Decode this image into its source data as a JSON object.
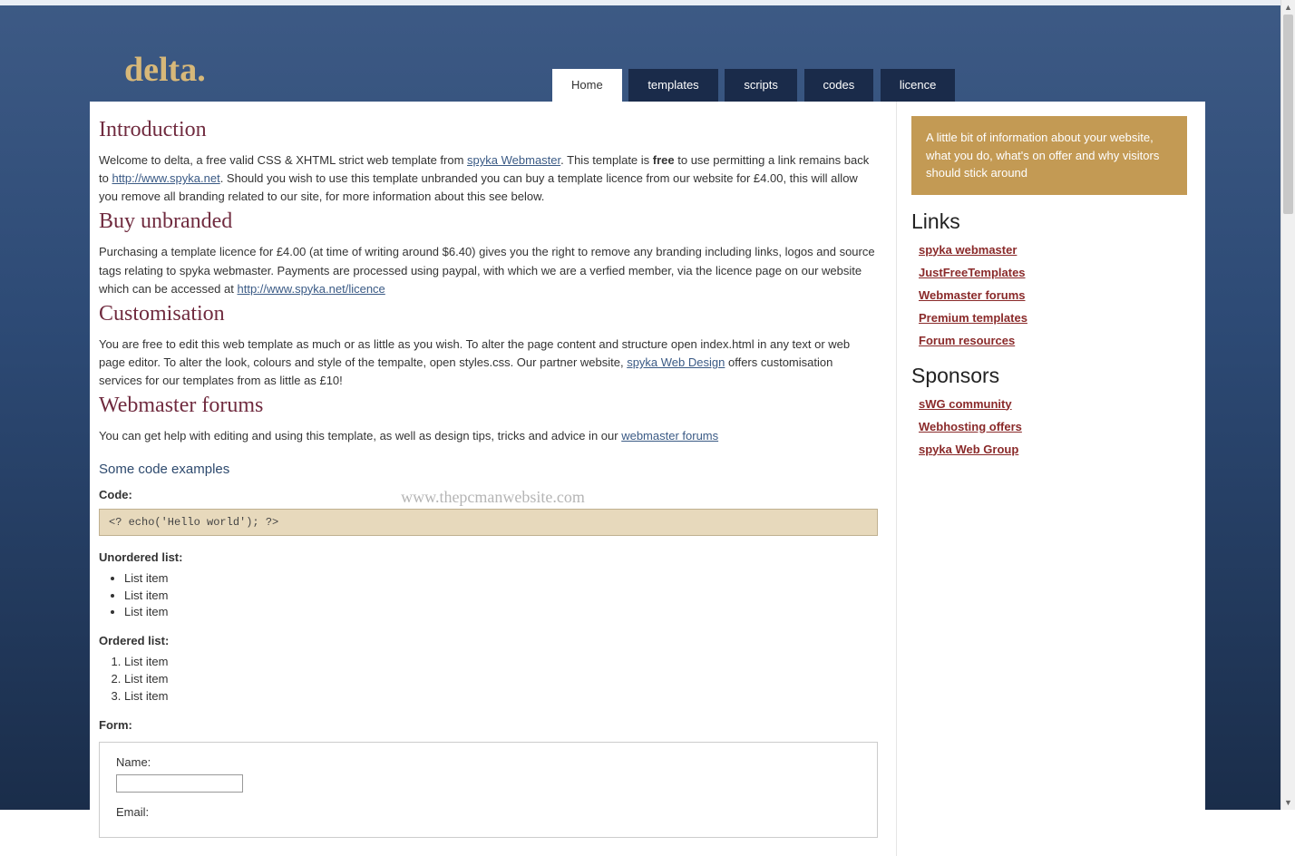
{
  "site": {
    "logo": "delta."
  },
  "nav": [
    {
      "label": "Home",
      "active": true
    },
    {
      "label": "templates",
      "active": false
    },
    {
      "label": "scripts",
      "active": false
    },
    {
      "label": "codes",
      "active": false
    },
    {
      "label": "licence",
      "active": false
    }
  ],
  "main": {
    "intro": {
      "heading": "Introduction",
      "p1a": "Welcome to delta, a free valid CSS & XHTML strict web template from ",
      "link1": "spyka Webmaster",
      "p1b": ". This template is ",
      "bold": "free",
      "p1c": " to use permitting a link remains back to ",
      "link2": "http://www.spyka.net",
      "p1d": ". Should you wish to use this template unbranded you can buy a template licence from our website for £4.00, this will allow you remove all branding related to our site, for more information about this see below."
    },
    "buy": {
      "heading": "Buy unbranded",
      "p1a": "Purchasing a template licence for £4.00 (at time of writing around $6.40) gives you the right to remove any branding including links, logos and source tags relating to spyka webmaster. Payments are processed using paypal, with which we are a verfied member, via the licence page on our website which can be accessed at ",
      "link1": "http://www.spyka.net/licence"
    },
    "custom": {
      "heading": "Customisation",
      "p1a": "You are free to edit this web template as much or as little as you wish. To alter the page content and structure open index.html in any text or web page editor. To alter the look, colours and style of the tempalte, open styles.css. Our partner website, ",
      "link1": "spyka Web Design",
      "p1b": " offers customisation services for our templates from as little as £10!"
    },
    "forums": {
      "heading": "Webmaster forums",
      "p1a": "You can get help with editing and using this template, as well as design tips, tricks and advice in our ",
      "link1": "webmaster forums"
    },
    "examples": {
      "heading": "Some code examples",
      "code_label": "Code:",
      "code": "<? echo('Hello world'); ?>",
      "ul_label": "Unordered list:",
      "ul": [
        "List item",
        "List item",
        "List item"
      ],
      "ol_label": "Ordered list:",
      "ol": [
        "List item",
        "List item",
        "List item"
      ],
      "form_label": "Form:",
      "form_name": "Name:",
      "form_email": "Email:"
    }
  },
  "sidebar": {
    "infobox": "A little bit of information about your website, what you do, what's on offer and why visitors should stick around",
    "links_heading": "Links",
    "links": [
      "spyka webmaster",
      "JustFreeTemplates",
      "Webmaster forums",
      "Premium templates",
      "Forum resources"
    ],
    "sponsors_heading": "Sponsors",
    "sponsors": [
      "sWG community",
      "Webhosting offers",
      "spyka Web Group"
    ]
  },
  "watermark": "www.thepcmanwebsite.com"
}
